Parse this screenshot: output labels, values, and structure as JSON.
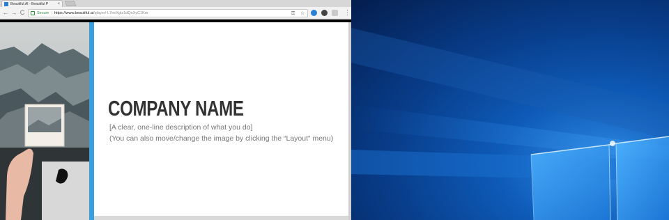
{
  "browser": {
    "tab_title": "Beautiful.AI - Beautiful P",
    "tab_close": "×",
    "nav": {
      "back": "←",
      "forward": "→",
      "reload": "C"
    },
    "omnibox": {
      "secure_label": "Secure",
      "separator": "|",
      "url_host": "https://www.beautiful.ai",
      "url_path": "/player/-L7eeXgIz1dQoXyC1Km"
    },
    "menu": "⋮"
  },
  "slide": {
    "title": "COMPANY NAME",
    "line1": "[A clear, one-line description of what you do]",
    "line2": "(You can also move/change the image by clicking the “Layout” menu)"
  },
  "colors": {
    "accent": "#3aa0dc",
    "secure": "#2e8b3a"
  }
}
